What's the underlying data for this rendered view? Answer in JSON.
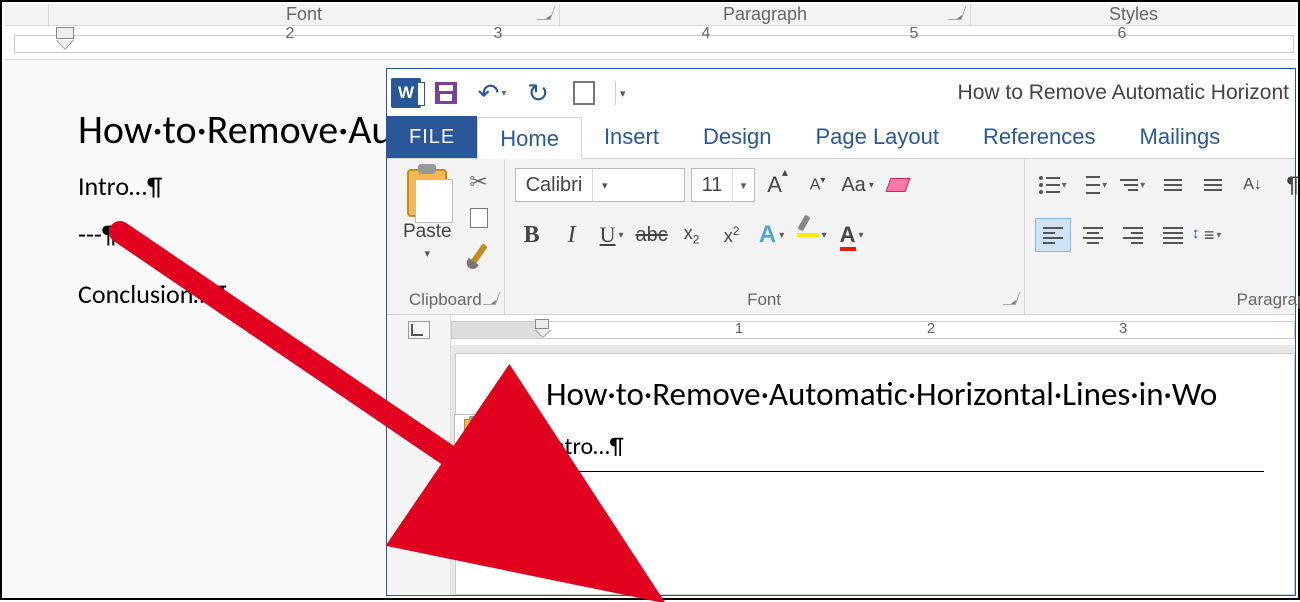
{
  "bg": {
    "groups": {
      "font": "Font",
      "paragraph": "Paragraph",
      "styles": "Styles"
    },
    "ruler_numbers": [
      "2",
      "3",
      "4",
      "5",
      "6"
    ],
    "doc": {
      "title": "How·to·Remove·Auto",
      "intro": "Intro…¶",
      "dashes": "---¶",
      "conclusion": "Conclusion…¶"
    }
  },
  "fg": {
    "doc_title": "How to Remove Automatic Horizont",
    "tabs": {
      "file": "FILE",
      "home": "Home",
      "insert": "Insert",
      "design": "Design",
      "page_layout": "Page Layout",
      "references": "References",
      "mailings": "Mailings"
    },
    "clipboard": {
      "paste": "Paste",
      "group": "Clipboard"
    },
    "font": {
      "name": "Calibri",
      "size": "11",
      "group": "Font",
      "bold": "B",
      "italic": "I",
      "underline": "U",
      "strike": "abc",
      "sub": "x",
      "sup": "x",
      "effects": "A",
      "fontcolor": "A",
      "case": "Aa"
    },
    "paragraph": {
      "group": "Paragrap",
      "sort": "A↓",
      "pilcrow": "¶"
    },
    "ruler_numbers": [
      "1",
      "2",
      "3"
    ],
    "page": {
      "title": "How·to·Remove·Automatic·Horizontal·Lines·in·Wo",
      "intro": "Intro…¶",
      "blank": "¶"
    }
  }
}
